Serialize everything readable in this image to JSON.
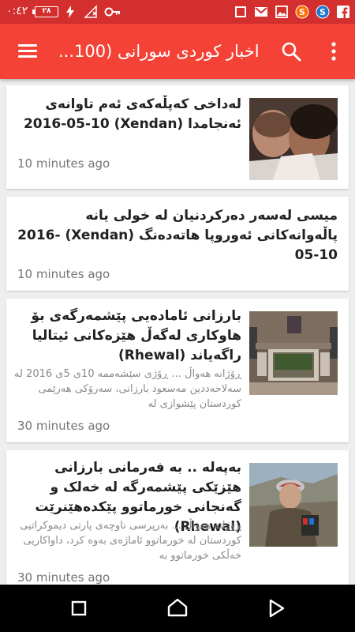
{
  "status_bar": {
    "time": "٠:٤٢",
    "battery": "٢٨"
  },
  "app_bar": {
    "title": "اخبار كوردی سورانی (100..."
  },
  "articles": [
    {
      "title": "لەداخی کەپڵەکەی ئەم تاوانەی ئەنجامدا (Xendan) 2016-05-10",
      "time": "10 minutes ago",
      "image": "woman-with-child-photo"
    },
    {
      "title": "میسی لەسەر دەرکردنیان لە خولی یانە پاڵەوانەکانی ئەوروپا هاتەدەنگ (Xendan) 2016-05-10",
      "time": "10 minutes ago"
    },
    {
      "title": "بارزانی ئامادەیی پێشمەرگەی بۆ هاوکاری لەگەڵ هێزەکانی ئیتالیا راگەیاند (Rhewal)",
      "summary": "ڕۆژانە هەواڵ ... ڕۆژی سێشەممە 10ی 5ی 2016 لە سەلاحەددین مەسعود بارزانی، سەرۆکی هەرێمی کوردستان پێشوازی لە",
      "time": "30 minutes ago",
      "image": "meeting-room-photo"
    },
    {
      "title": "بەپەلە .. بە فەرمانی بارزانی هێزێکی پێشمەرگە لە خەلک و گەنجانی خورماتوو پێکدەهێنرێت (Rhewal)",
      "summary": "ڕۆژانە هەواڵ ... بەرپرسی ناوچەی پارتی دیموکراتیی کوردستان لە خورماتوو ئاماژەی بەوە کرد، داواکاریی خەڵکی خورماتوو بە",
      "time": "30 minutes ago",
      "image": "barzani-speaking-photo"
    }
  ]
}
